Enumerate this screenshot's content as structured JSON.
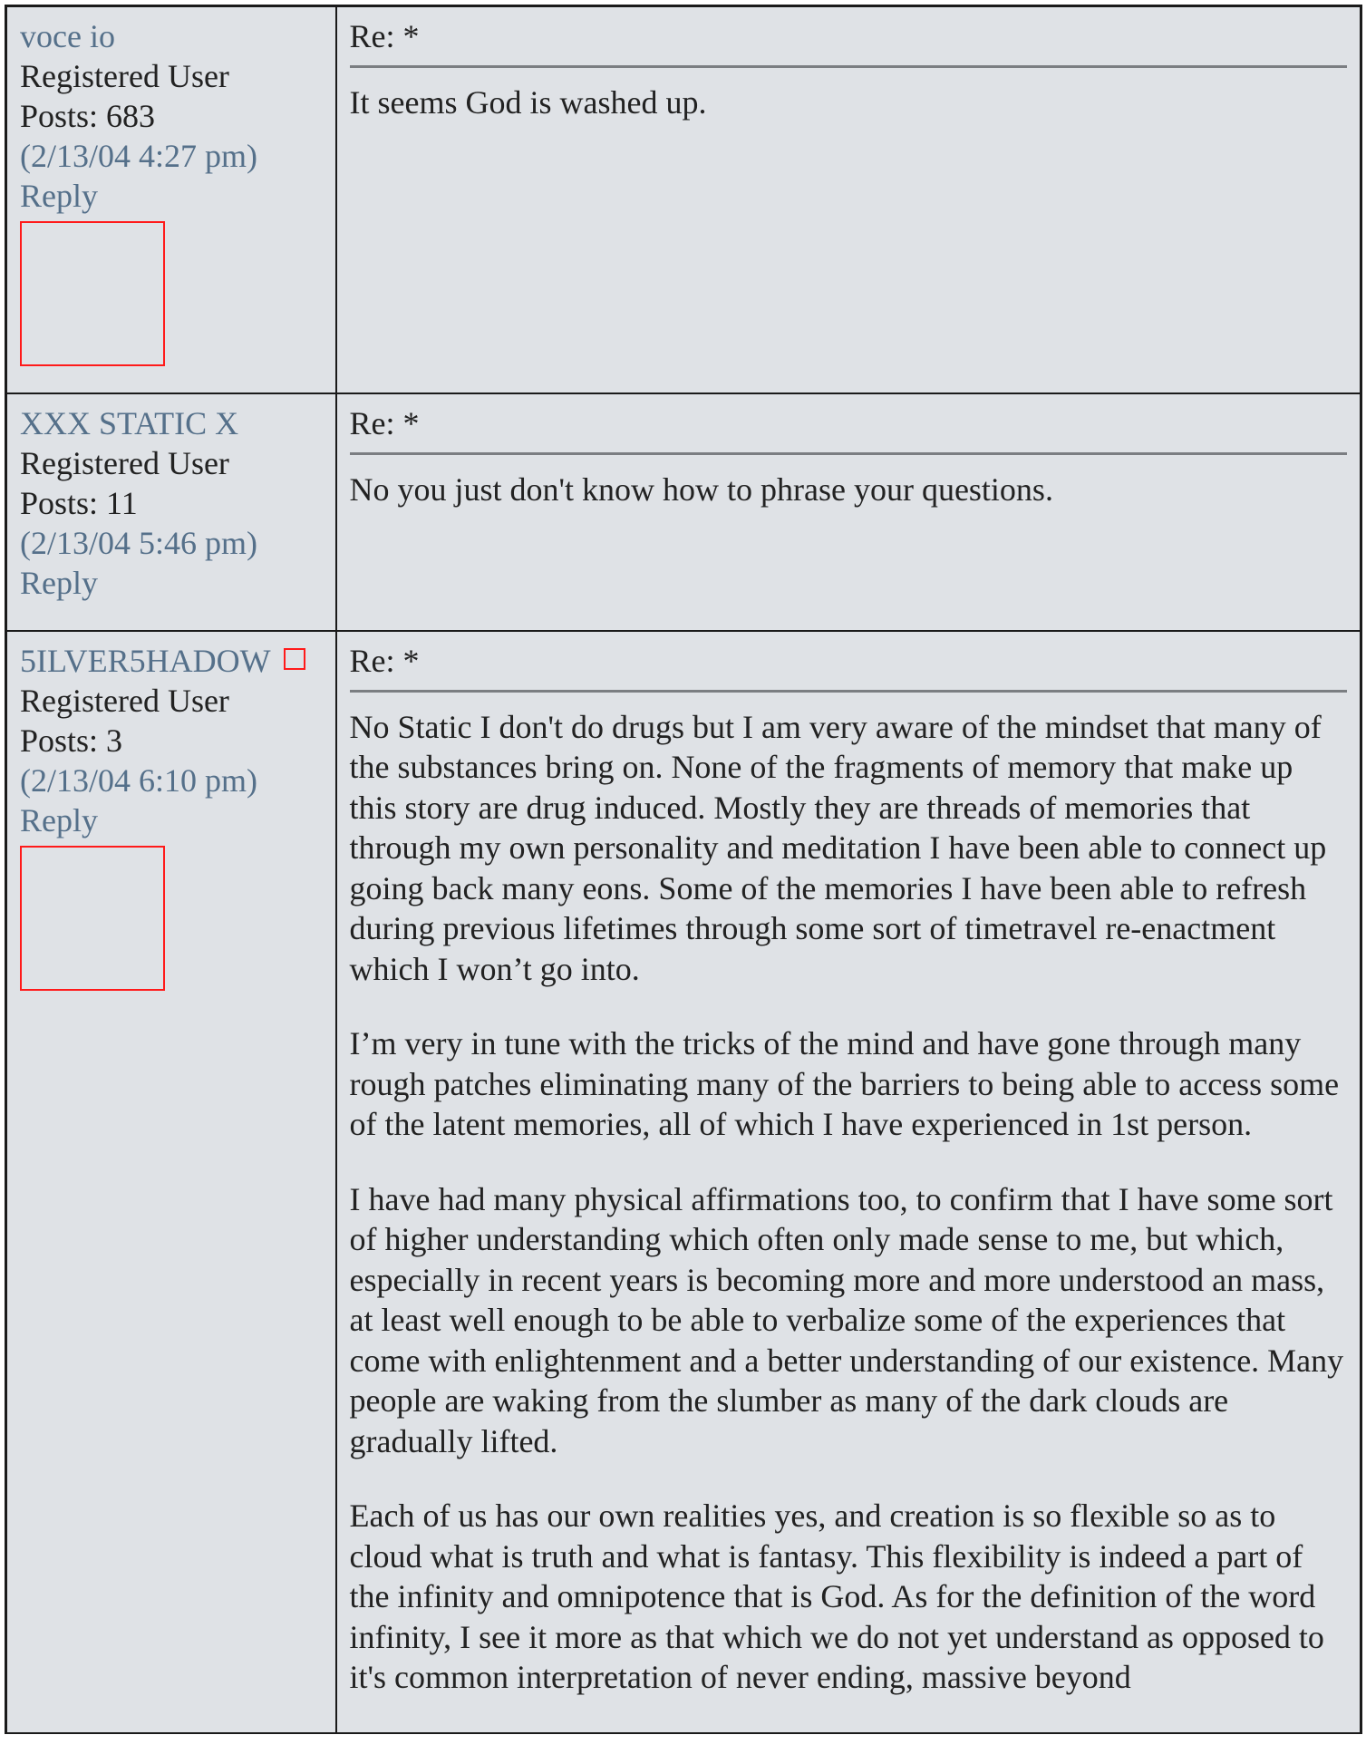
{
  "posts": [
    {
      "author": "voce io",
      "role": "Registered User",
      "posts_count": "Posts: 683",
      "timestamp": "(2/13/04 4:27 pm)",
      "reply_label": "Reply",
      "subject": "Re: *",
      "body": [
        "It seems God is washed up."
      ]
    },
    {
      "author": "XXX STATIC X",
      "role": "Registered User",
      "posts_count": "Posts: 11",
      "timestamp": "(2/13/04 5:46 pm)",
      "reply_label": "Reply",
      "subject": "Re: *",
      "body": [
        "No you just don't know how to phrase your questions."
      ]
    },
    {
      "author": "5ILVER5HADOW",
      "role": "Registered User",
      "posts_count": "Posts: 3",
      "timestamp": "(2/13/04 6:10 pm)",
      "reply_label": "Reply",
      "subject": "Re: *",
      "body": [
        "No Static I don't do drugs but I am very aware of the mindset that many of the substances bring on. None of the fragments of memory that make up this story are drug induced. Mostly they are threads of memories that through my own personality and meditation I have been able to connect up going back many eons. Some of the memories I have been able to refresh during previous lifetimes through some sort of timetravel re-enactment which I won’t go into.",
        "I’m very in tune with the tricks of the mind and have gone through many rough patches eliminating many of the barriers to being able to access some of the latent memories, all of which I have experienced in 1st person.",
        "I have had many physical affirmations too, to confirm that I have some sort of higher understanding which often only made sense to me, but which, especially in recent years is becoming more and more understood an mass, at least well enough to be able to verbalize some of the experiences that come with enlightenment and a better understanding of our existence. Many people are waking from the slumber as many of the dark clouds are gradually lifted.",
        "Each of us has our own realities yes, and creation is so flexible so as to cloud what is truth and what is fantasy. This flexibility is indeed a part of the infinity and omnipotence that is God. As for the definition of the word infinity, I see it more as that which we do not yet understand as opposed to it's common interpretation of never ending, massive beyond"
      ]
    }
  ]
}
